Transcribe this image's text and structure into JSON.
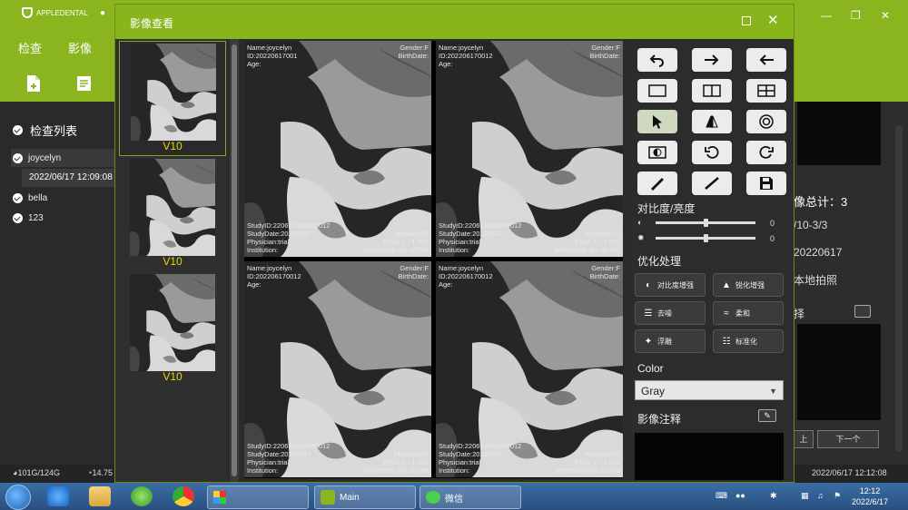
{
  "app": {
    "logo_text": "APPLEDENTAL",
    "menu": [
      "检查",
      "影像"
    ],
    "list_title": "检查列表",
    "patients": [
      {
        "name": "joycelyn",
        "date": "2022/06/17 12:09:08"
      },
      {
        "name": "bella"
      },
      {
        "name": "123"
      }
    ],
    "right_panel": {
      "total": "像总计：3",
      "lines": [
        "/10-3/3",
        "20220617",
        "本地拍照",
        "择"
      ],
      "prev_btn": "上",
      "next_btn": "下一个"
    },
    "status": {
      "disk": "101G/124G",
      "mem": "14.75",
      "datetime": "2022/06/17 12:12:08"
    }
  },
  "viewer": {
    "title": "影像查看",
    "thumbnails": [
      {
        "label": "V10",
        "selected": true
      },
      {
        "label": "V10",
        "selected": false
      },
      {
        "label": "V10",
        "selected": false
      }
    ],
    "cells": [
      {
        "tl": [
          "Name:joycelyn",
          "ID:20220617001",
          "Age:"
        ],
        "tr": [
          "Gender:F",
          "BirthDate:"
        ],
        "bl": [
          "StudyID:220617060050012",
          "StudyDate:20220617",
          "Physician:trial",
          "Institution:"
        ],
        "br": [
          "Modality:IO",
          "PloD: 1 : 1.271",
          "WW:65536  WL:32768"
        ],
        "selected": false
      },
      {
        "tl": [
          "Name:joycelyn",
          "ID:202206170012",
          "Age:"
        ],
        "tr": [
          "Gender:F",
          "BirthDate:"
        ],
        "bl": [
          "StudyID:220617060050012",
          "StudyDate:20220617",
          "Physician:trial",
          "Institution:"
        ],
        "br": [
          "Modality:IO",
          "PloD: 1 : 1.271",
          "WW:65536  WL:32768"
        ],
        "selected": false
      },
      {
        "tl": [
          "Name:joycelyn",
          "ID:202206170012",
          "Age:"
        ],
        "tr": [
          "Gender:F",
          "BirthDate:"
        ],
        "bl": [
          "StudyID:220617060050012",
          "StudyDate:20220617",
          "Physician:trial",
          "Institution:"
        ],
        "br": [
          "Modality:IO",
          "PloD: 1 : 1.271",
          "WW:65536  WL:32768"
        ],
        "selected": false
      },
      {
        "tl": [
          "Name:joycelyn",
          "ID:202206170012",
          "Age:"
        ],
        "tr": [
          "Gender:F",
          "BirthDate:"
        ],
        "bl": [
          "StudyID:220617060050012",
          "StudyDate:20220617",
          "Physician:trial",
          "Institution:"
        ],
        "br": [
          "Modality:IO",
          "PloD: 1 : 1.271",
          "WW:65536  WL:32768"
        ],
        "selected": true
      }
    ],
    "tools": {
      "contrast_title": "对比度/亮度",
      "contrast_value": "0",
      "brightness_value": "0",
      "contrast_level": 0.5,
      "brightness_level": 0.5,
      "optimize_title": "优化处理",
      "optimize_buttons": [
        "对比度增强",
        "锐化增强",
        "去噪",
        "柔和",
        "浮雕",
        "标准化"
      ],
      "color_title": "Color",
      "color_value": "Gray",
      "annotation_title": "影像注释"
    }
  },
  "taskbar": {
    "tasks": [
      {
        "label": ""
      },
      {
        "label": "Main"
      },
      {
        "label": "微信"
      }
    ],
    "clock_time": "12:12",
    "clock_date": "2022/6/17"
  }
}
